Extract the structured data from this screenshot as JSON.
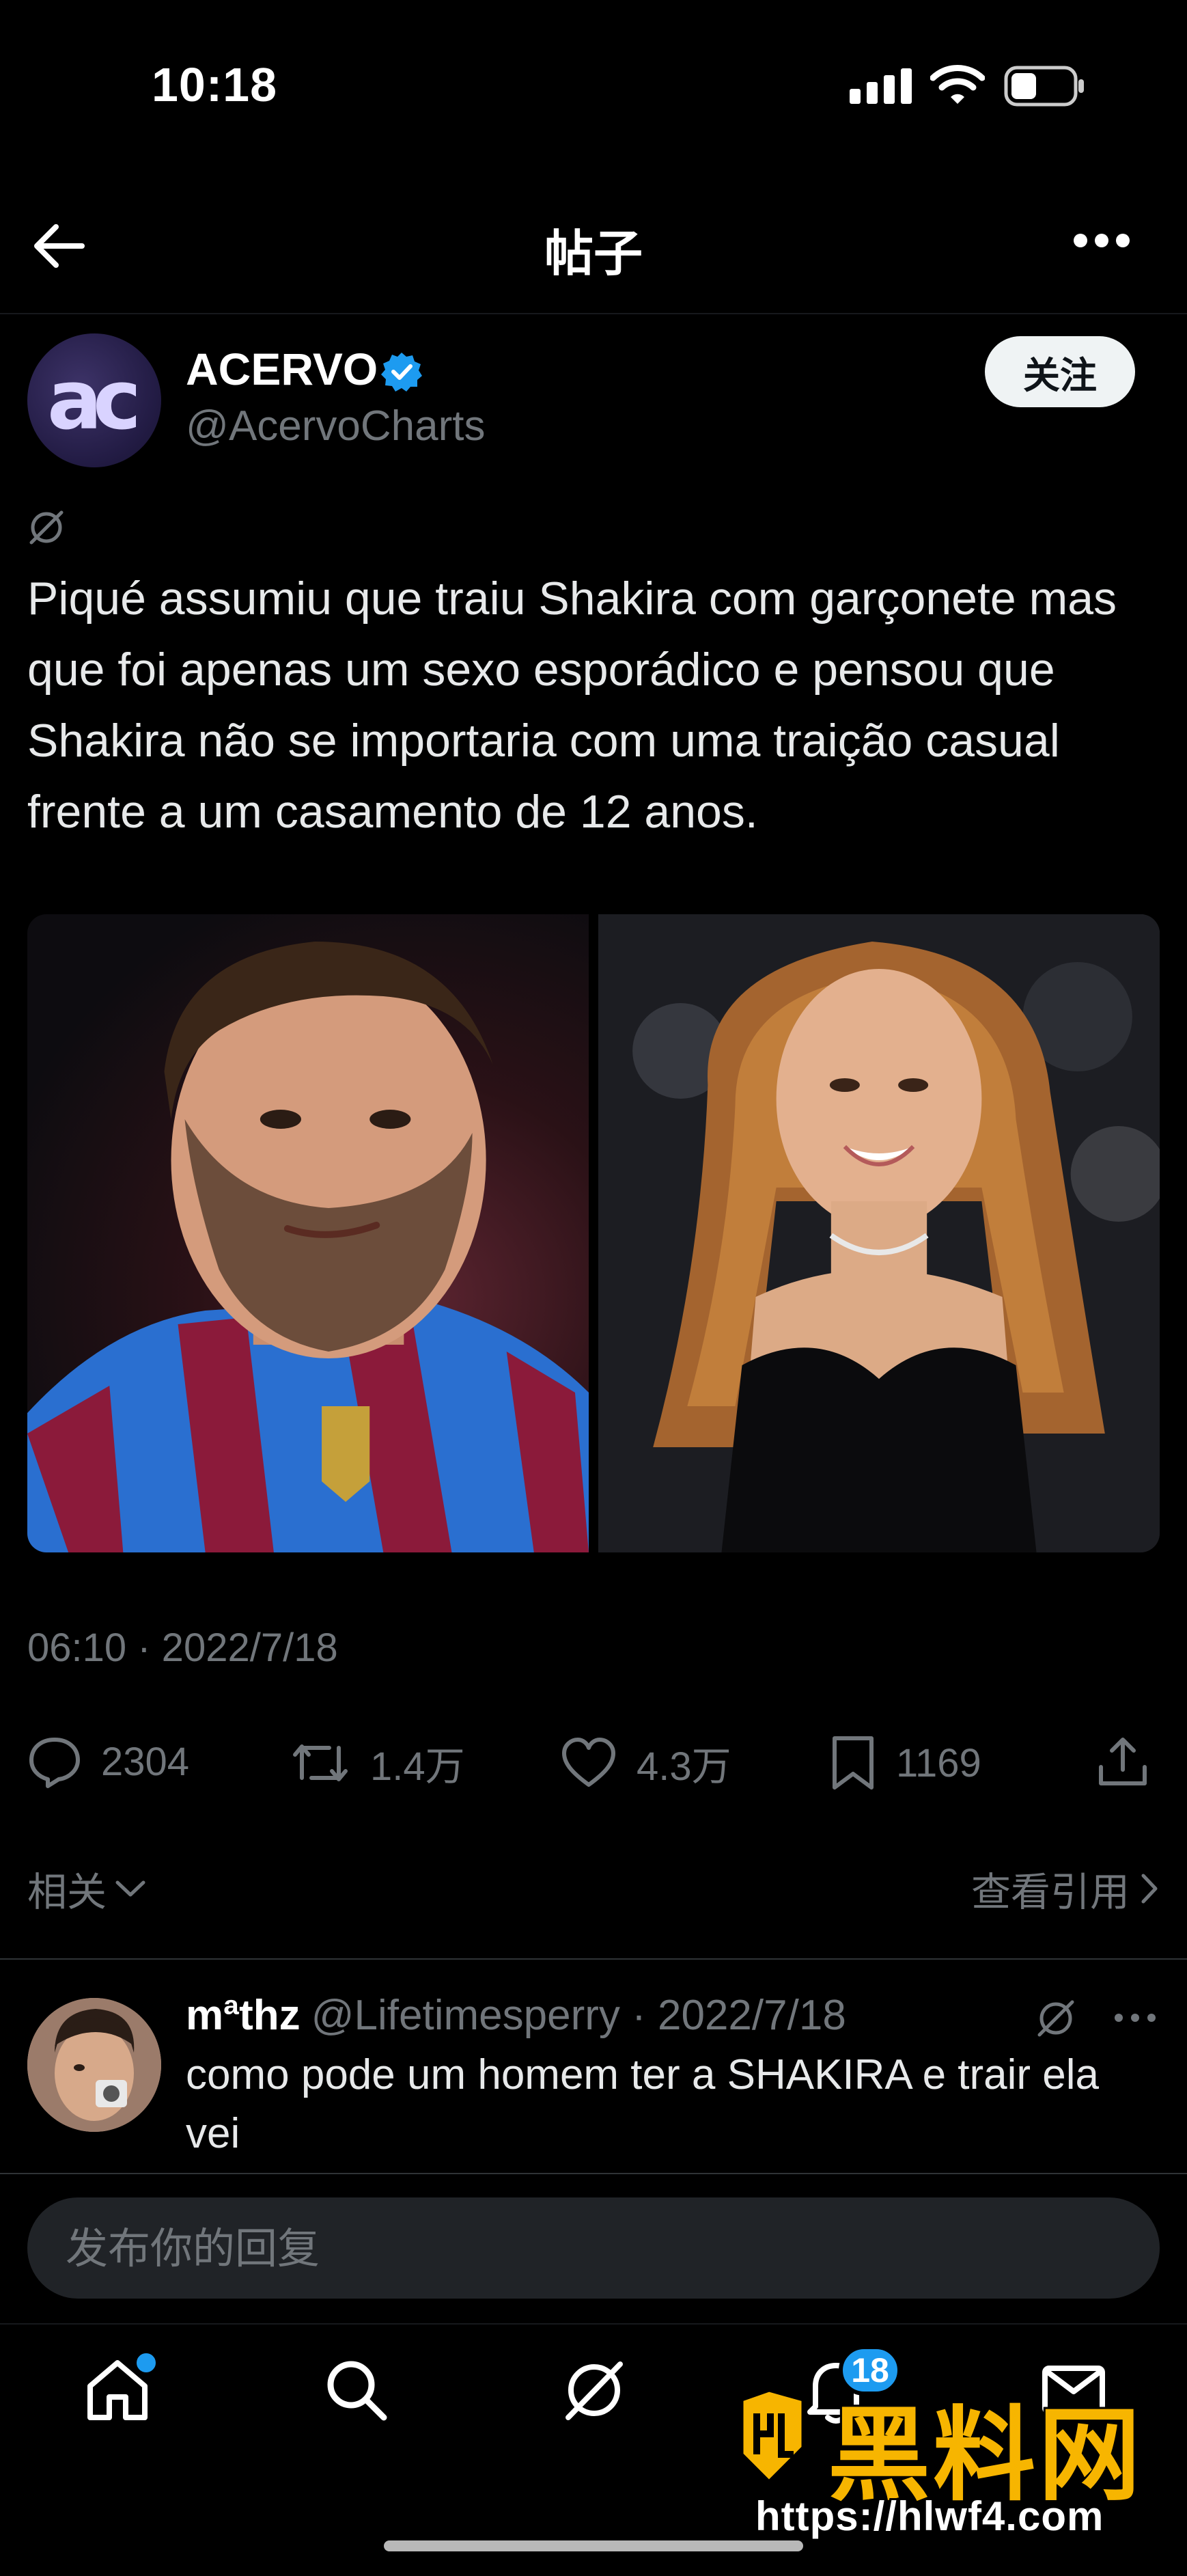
{
  "status_bar": {
    "time": "10:18"
  },
  "nav": {
    "title": "帖子"
  },
  "author": {
    "avatar_text": "ac",
    "name": "ACERVO",
    "handle": "@AcervoCharts",
    "follow_label": "关注"
  },
  "tweet": {
    "text": "Piqué assumiu que traiu Shakira com garçonete mas que foi apenas um sexo esporádico e pensou que Shakira não se importaria com uma traição casual frente a um casamento de 12 anos.",
    "timestamp": "06:10 · 2022/7/18",
    "stats": {
      "replies": "2304",
      "retweets": "1.4万",
      "likes": "4.3万",
      "bookmarks": "1169"
    }
  },
  "related": {
    "label": "相关",
    "quotes_label": "查看引用"
  },
  "reply": {
    "name": "mªthz",
    "handle_date": "@Lifetimesperry · 2022/7/18",
    "text": "como pode um homem ter a SHAKIRA e trair ela vei"
  },
  "composer": {
    "placeholder": "发布你的回复"
  },
  "tabbar": {
    "notifications_badge": "18"
  },
  "watermark": {
    "brand": "黑料网",
    "url": "https://hlwf4.com"
  },
  "colors": {
    "accent": "#1d9bf0",
    "muted": "#71767b",
    "background": "#000000",
    "watermark": "#f7b500"
  }
}
